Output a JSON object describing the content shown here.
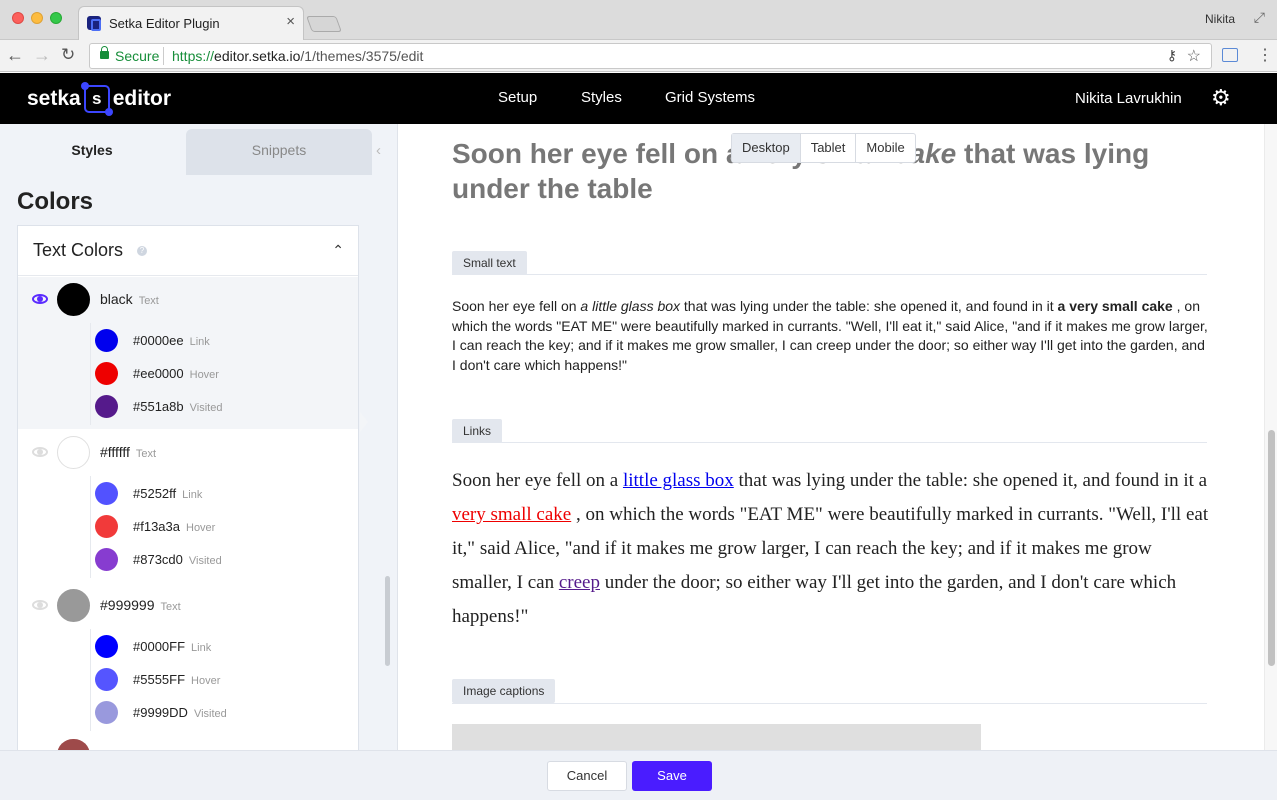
{
  "browser": {
    "tab_title": "Setka Editor Plugin",
    "profile": "Nikita",
    "secure_label": "Secure",
    "url_scheme": "https://",
    "url_host": "editor.setka.io",
    "url_path": "/1/themes/3575/edit"
  },
  "app": {
    "logo_left": "setka",
    "logo_badge": "s",
    "logo_right": "editor",
    "nav": [
      "Setup",
      "Styles",
      "Grid Systems"
    ],
    "user": "Nikita Lavrukhin"
  },
  "sidebar": {
    "tabs": [
      "Styles",
      "Snippets"
    ],
    "section_title": "Colors",
    "panel_title": "Text Colors",
    "groups": [
      {
        "name": "black",
        "type": "Text",
        "color": "#000000",
        "subs": [
          {
            "name": "#0000ee",
            "type": "Link",
            "color": "#0000ee"
          },
          {
            "name": "#ee0000",
            "type": "Hover",
            "color": "#ee0000"
          },
          {
            "name": "#551a8b",
            "type": "Visited",
            "color": "#551a8b"
          }
        ]
      },
      {
        "name": "#ffffff",
        "type": "Text",
        "color": "#ffffff",
        "subs": [
          {
            "name": "#5252ff",
            "type": "Link",
            "color": "#5252ff"
          },
          {
            "name": "#f13a3a",
            "type": "Hover",
            "color": "#f13a3a"
          },
          {
            "name": "#873cd0",
            "type": "Visited",
            "color": "#873cd0"
          }
        ]
      },
      {
        "name": "#999999",
        "type": "Text",
        "color": "#999999",
        "subs": [
          {
            "name": "#0000FF",
            "type": "Link",
            "color": "#0000ff"
          },
          {
            "name": "#5555FF",
            "type": "Hover",
            "color": "#5555ff"
          },
          {
            "name": "#9999DD",
            "type": "Visited",
            "color": "#9999dd"
          }
        ]
      }
    ]
  },
  "preview": {
    "headline_a": "Soon her eye fell on a very small ",
    "headline_em": "cake",
    "headline_b": " that was lying under the table",
    "devices": [
      "Desktop",
      "Tablet",
      "Mobile"
    ],
    "sections": [
      "Small text",
      "Links",
      "Image captions"
    ],
    "small": {
      "p1": "Soon her eye fell on ",
      "em": "a little glass box",
      "p2": " that was lying under the table: she opened it, and found in it ",
      "strong": "a very small cake",
      "p3": " , on which the words \"EAT ME\" were beautifully marked in currants. \"Well, I'll eat it,\" said Alice, \"and if it makes me grow larger, I can reach the key; and if it makes me grow smaller, I can creep under the door; so either way I'll get into the garden, and I don't care which happens!\""
    },
    "links": {
      "p1": "Soon her eye fell on a ",
      "l1": " little glass box",
      "p2": " that was lying under the table: she opened it, and found in it a ",
      "l2": "very small cake",
      "p3": " , on which the words \"EAT ME\" were beautifully marked in currants. \"Well, I'll eat it,\" said Alice, \"and if it makes me grow larger, I can reach the key; and if it makes me grow smaller, I can ",
      "l3": "creep",
      "p4": " under the door; so either way I'll get into the garden, and I don't care which happens!\""
    }
  },
  "footer": {
    "cancel": "Cancel",
    "save": "Save"
  }
}
